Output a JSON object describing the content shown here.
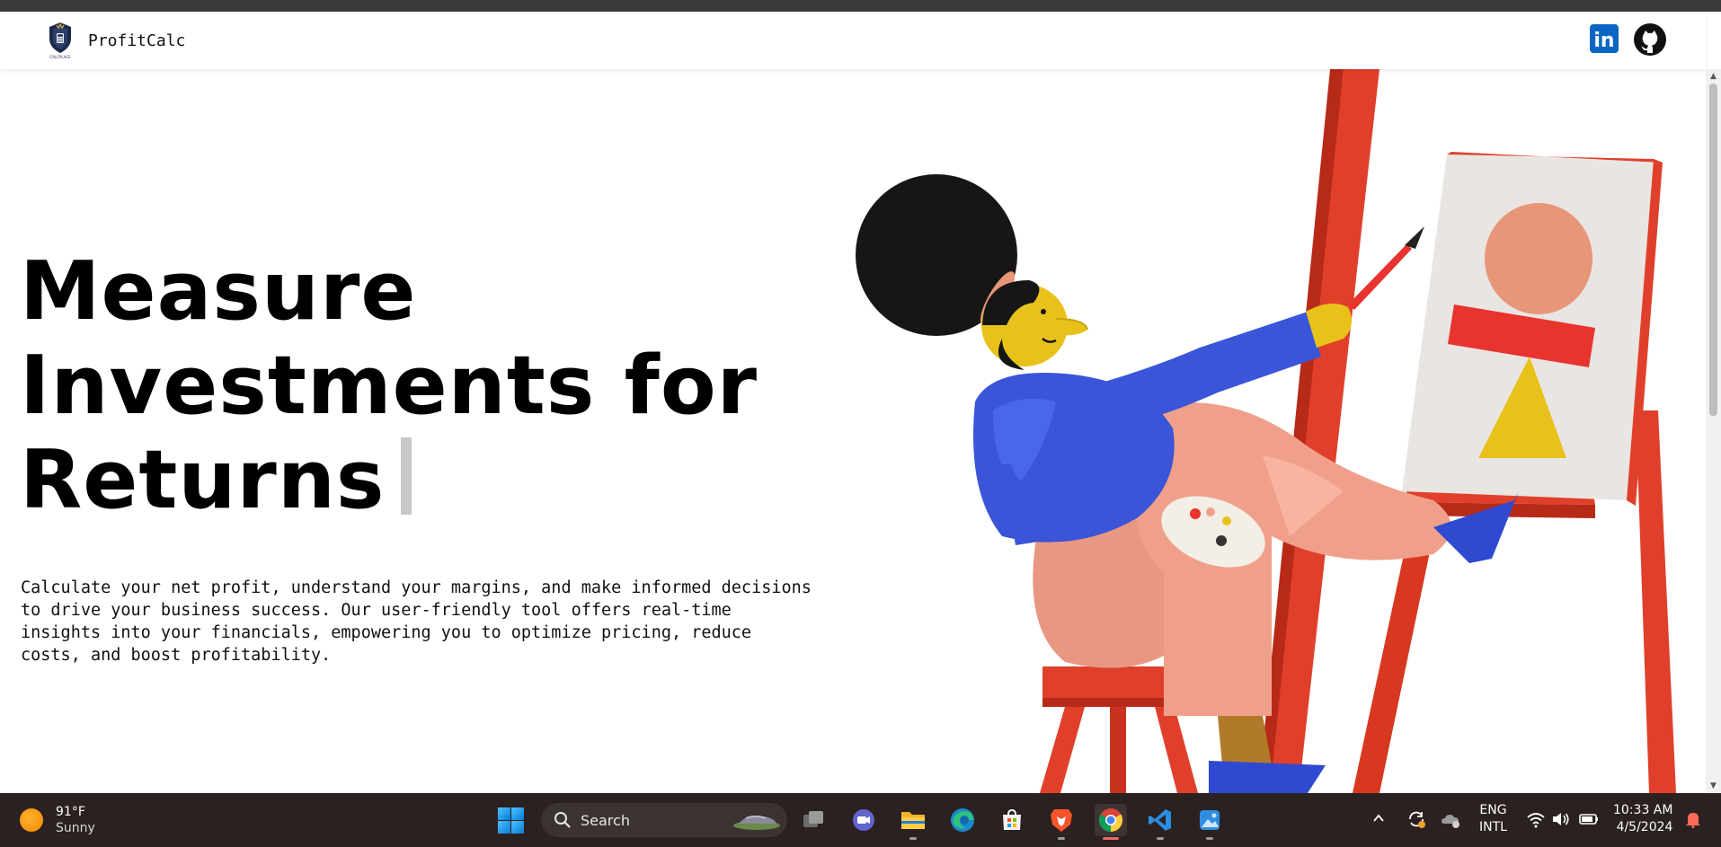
{
  "navbar": {
    "brand_name": "ProfitCalc",
    "logo_caption": "CALCPLACE"
  },
  "hero": {
    "title_line1": "Measure",
    "title_line2": "Investments for",
    "title_line3": "Returns",
    "description_line1": "Calculate your net profit, understand your margins, and make informed decisions",
    "description_line2": "to drive your business success. Our user-friendly tool offers real-time",
    "description_line3": "insights into your financials, empowering you to optimize pricing, reduce",
    "description_line4": "costs, and boost profitability."
  },
  "social": {
    "linkedin_text": "in"
  },
  "taskbar": {
    "weather_temp": "91°F",
    "weather_condition": "Sunny",
    "search_label": "Search",
    "lang_line1": "ENG",
    "lang_line2": "INTL",
    "time": "10:33 AM",
    "date": "4/5/2024"
  },
  "colors": {
    "taskbar_bg": "#2a2120",
    "linkedin_blue": "#0a66c2",
    "easel_red": "#e0402b",
    "shirt_blue": "#3a55d8",
    "pants_pink": "#f0a08a"
  }
}
